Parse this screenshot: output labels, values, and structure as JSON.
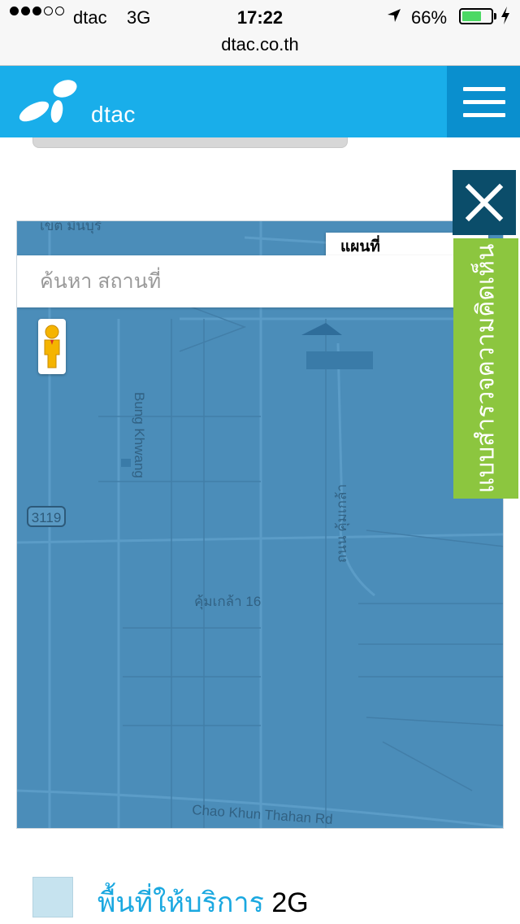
{
  "status_bar": {
    "carrier": "dtac",
    "network": "3G",
    "time": "17:22",
    "battery_percent": "66%",
    "icons": [
      "signal-dots-icon",
      "location-arrow-icon",
      "battery-icon",
      "charging-bolt-icon"
    ]
  },
  "address_bar": {
    "url": "dtac.co.th"
  },
  "header": {
    "brand": "dtac",
    "brand_color": "#19aeea",
    "menu_button_color": "#0a8fce",
    "icons": [
      "dtac-logo-icon",
      "hamburger-menu-icon"
    ]
  },
  "map": {
    "type_selector": "แผนที่",
    "search_placeholder": "ค้นหา สถานที่",
    "overlay_color": "#4b8db9",
    "labels": {
      "top_left": "เขต มีนบุรี",
      "road_bung_khwang": "Bung Khwang",
      "road_khum_klao": "ถนน คุ้มเกล้า",
      "soi_khum_klao_16": "คุ้มเกล้า 16",
      "road_chao_khun_thahan": "Chao Khun Thahan Rd",
      "route_number": "3119"
    },
    "icons": [
      "pegman-street-view-icon"
    ]
  },
  "feedback": {
    "close_icon": "close-icon",
    "tab_label": "แบบสำรวจความคิดเห็น",
    "tab_color": "#8cc63f",
    "close_color": "#0b4d6a"
  },
  "legend": {
    "label_thai": "พื้นที่ให้บริการ",
    "label_gen": "2G",
    "swatch_color": "#c6e3ef"
  }
}
